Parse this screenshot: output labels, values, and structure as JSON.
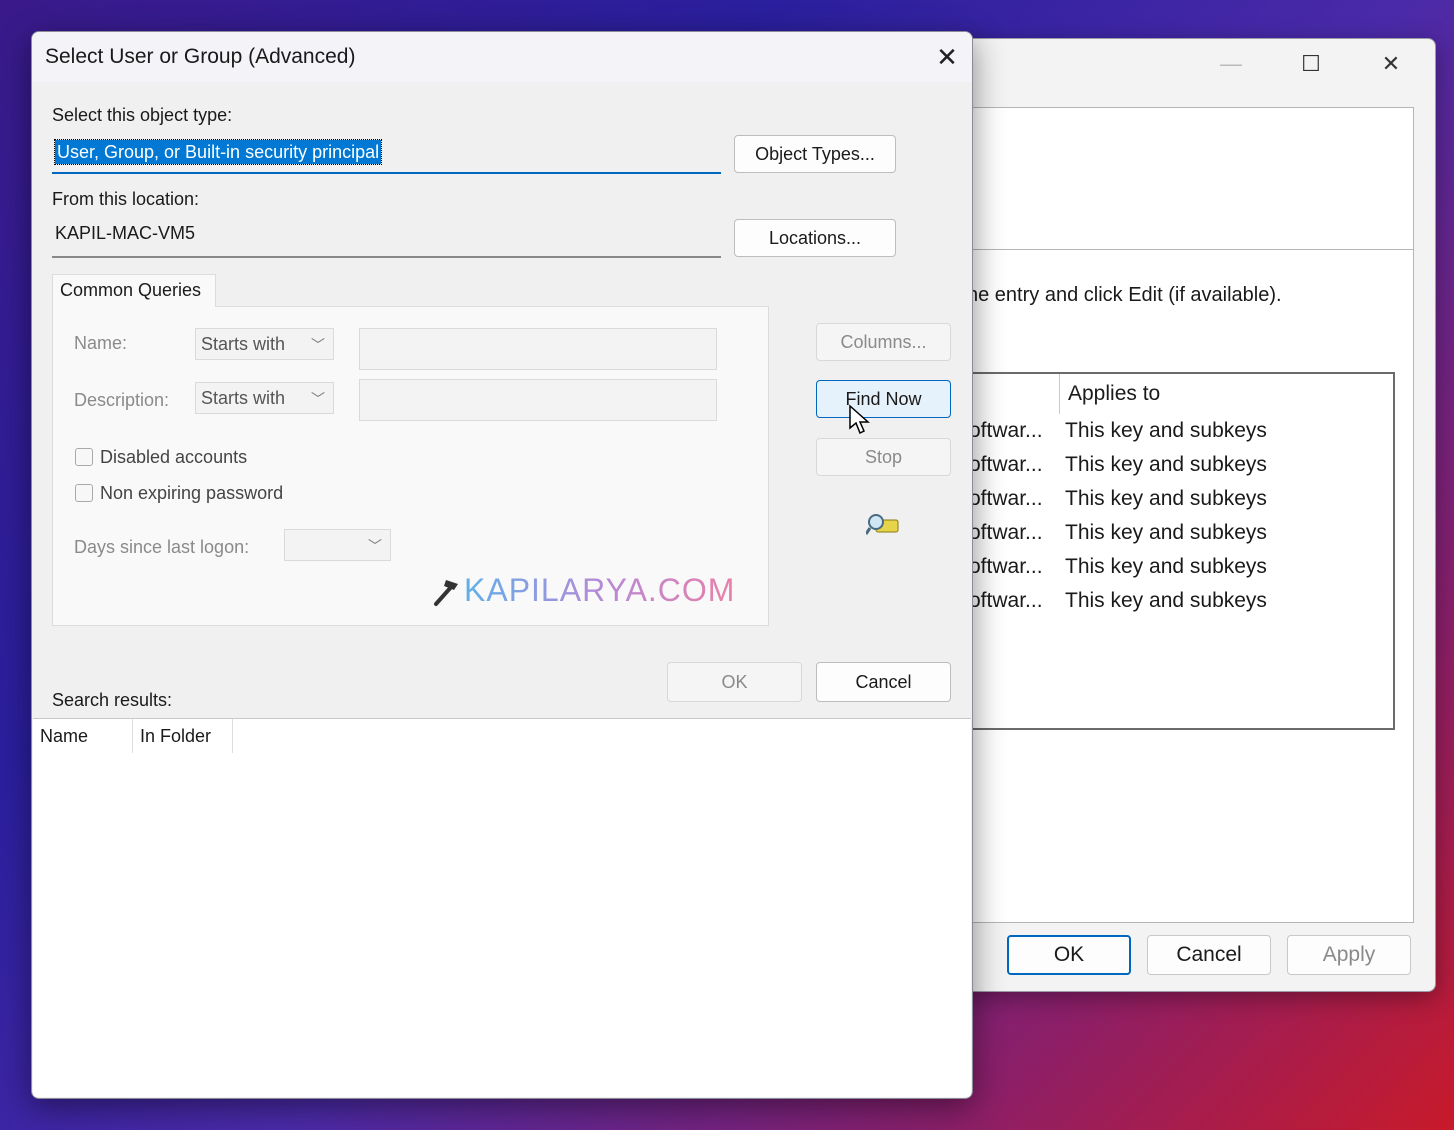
{
  "background_window": {
    "instruction_text": "ne entry and click Edit (if available).",
    "list": {
      "column_applies_to": "Applies to",
      "rows": [
        {
          "name": "oftwar...",
          "applies_to": "This key and subkeys"
        },
        {
          "name": "oftwar...",
          "applies_to": "This key and subkeys"
        },
        {
          "name": "oftwar...",
          "applies_to": "This key and subkeys"
        },
        {
          "name": "oftwar...",
          "applies_to": "This key and subkeys"
        },
        {
          "name": "oftwar...",
          "applies_to": "This key and subkeys"
        },
        {
          "name": "oftwar...",
          "applies_to": "This key and subkeys"
        }
      ]
    },
    "buttons": {
      "ok": "OK",
      "cancel": "Cancel",
      "apply": "Apply"
    },
    "controls": {
      "minimize_glyph": "—",
      "maximize_glyph": "☐",
      "close_glyph": "✕"
    }
  },
  "dialog": {
    "title": "Select User or Group (Advanced)",
    "close_glyph": "✕",
    "object_type": {
      "label": "Select this object type:",
      "value": "User, Group, or Built-in security principal",
      "button": "Object Types..."
    },
    "location": {
      "label": "From this location:",
      "value": "KAPIL-MAC-VM5",
      "button": "Locations..."
    },
    "common_queries": {
      "tab_label": "Common Queries",
      "name_label": "Name:",
      "name_mode": "Starts with",
      "description_label": "Description:",
      "description_mode": "Starts with",
      "disabled_accounts": "Disabled accounts",
      "non_expiring_password": "Non expiring password",
      "days_since_logon_label": "Days since last logon:",
      "watermark": "KAPILARYA.COM"
    },
    "side_buttons": {
      "columns": "Columns...",
      "find_now": "Find Now",
      "stop": "Stop"
    },
    "ok": "OK",
    "cancel": "Cancel",
    "search_results": {
      "label": "Search results:",
      "columns": [
        "Name",
        "In Folder"
      ]
    }
  },
  "colors": {
    "accent": "#0067c0",
    "selection": "#0078d4"
  },
  "icons": {
    "search_icon": "flashlight-search-icon",
    "cursor": "mouse-pointer-icon",
    "watermark_icon": "hammer-icon"
  }
}
